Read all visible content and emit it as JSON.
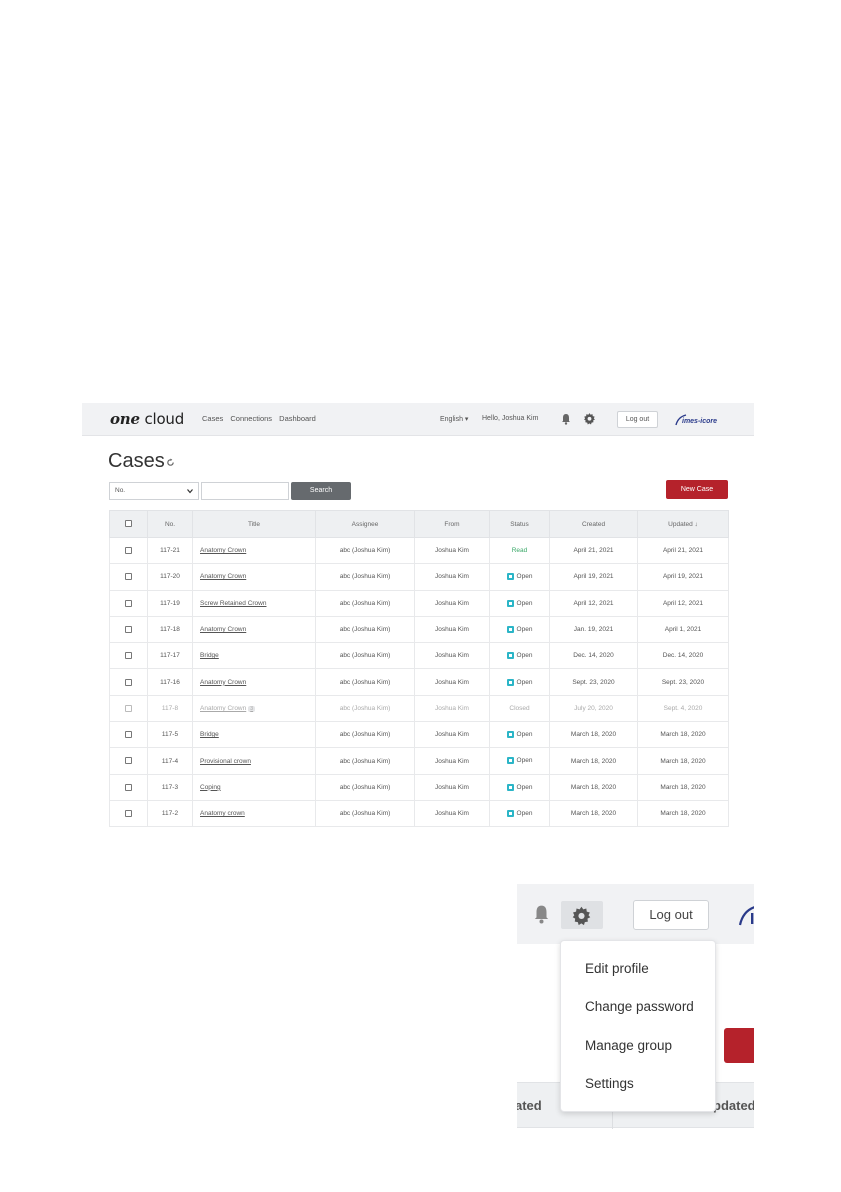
{
  "navbar": {
    "logo_one": "one",
    "logo_cloud": "cloud",
    "links": [
      "Cases",
      "Connections",
      "Dashboard"
    ],
    "language": "English ▾",
    "greeting": "Hello, Joshua Kim",
    "logout_label": "Log out",
    "partner_logo": "imes-icore"
  },
  "page": {
    "title": "Cases",
    "filter_selected": "No.",
    "search_value": "",
    "search_label": "Search",
    "new_case_label": "New Case"
  },
  "table": {
    "headers": [
      "",
      "No.",
      "Title",
      "Assignee",
      "From",
      "Status",
      "Created",
      "Updated ↓"
    ],
    "rows": [
      {
        "no": "117-21",
        "title": "Anatomy Crown",
        "assignee": "abc (Joshua Kim)",
        "from": "Joshua Kim",
        "status": "Read",
        "status_type": "read",
        "created": "April 21, 2021",
        "updated": "April 21, 2021"
      },
      {
        "no": "117-20",
        "title": "Anatomy Crown",
        "assignee": "abc (Joshua Kim)",
        "from": "Joshua Kim",
        "status": "Open",
        "status_type": "open",
        "created": "April 19, 2021",
        "updated": "April 19, 2021"
      },
      {
        "no": "117-19",
        "title": "Screw Retained Crown",
        "assignee": "abc (Joshua Kim)",
        "from": "Joshua Kim",
        "status": "Open",
        "status_type": "open",
        "created": "April 12, 2021",
        "updated": "April 12, 2021"
      },
      {
        "no": "117-18",
        "title": "Anatomy Crown",
        "assignee": "abc (Joshua Kim)",
        "from": "Joshua Kim",
        "status": "Open",
        "status_type": "open",
        "created": "Jan. 19, 2021",
        "updated": "April 1, 2021"
      },
      {
        "no": "117-17",
        "title": "Bridge",
        "assignee": "abc (Joshua Kim)",
        "from": "Joshua Kim",
        "status": "Open",
        "status_type": "open",
        "created": "Dec. 14, 2020",
        "updated": "Dec. 14, 2020"
      },
      {
        "no": "117-16",
        "title": "Anatomy Crown",
        "assignee": "abc (Joshua Kim)",
        "from": "Joshua Kim",
        "status": "Open",
        "status_type": "open",
        "created": "Sept. 23, 2020",
        "updated": "Sept. 23, 2020"
      },
      {
        "no": "117-8",
        "title": "Anatomy Crown",
        "count": "3",
        "assignee": "abc (Joshua Kim)",
        "from": "Joshua Kim",
        "status": "Closed",
        "status_type": "closed",
        "created": "July 20, 2020",
        "updated": "Sept. 4, 2020"
      },
      {
        "no": "117-5",
        "title": "Bridge",
        "assignee": "abc (Joshua Kim)",
        "from": "Joshua Kim",
        "status": "Open",
        "status_type": "open",
        "created": "March 18, 2020",
        "updated": "March 18, 2020"
      },
      {
        "no": "117-4",
        "title": "Provisional crown",
        "assignee": "abc (Joshua Kim)",
        "from": "Joshua Kim",
        "status": "Open",
        "status_type": "open",
        "created": "March 18, 2020",
        "updated": "March 18, 2020"
      },
      {
        "no": "117-3",
        "title": "Coping",
        "assignee": "abc (Joshua Kim)",
        "from": "Joshua Kim",
        "status": "Open",
        "status_type": "open",
        "created": "March 18, 2020",
        "updated": "March 18, 2020"
      },
      {
        "no": "117-2",
        "title": "Anatomy crown",
        "assignee": "abc (Joshua Kim)",
        "from": "Joshua Kim",
        "status": "Open",
        "status_type": "open",
        "created": "March 18, 2020",
        "updated": "March 18, 2020"
      }
    ]
  },
  "zoom": {
    "logout_label": "Log out",
    "header_left": "ated",
    "header_right": "pdated ↓",
    "menu": [
      "Edit profile",
      "Change password",
      "Manage group",
      "Settings"
    ]
  },
  "colors": {
    "brand_red": "#b5222b",
    "open_badge": "#2bb5c7",
    "read_green": "#3aa868",
    "navbar_bg": "#f1f2f4"
  }
}
